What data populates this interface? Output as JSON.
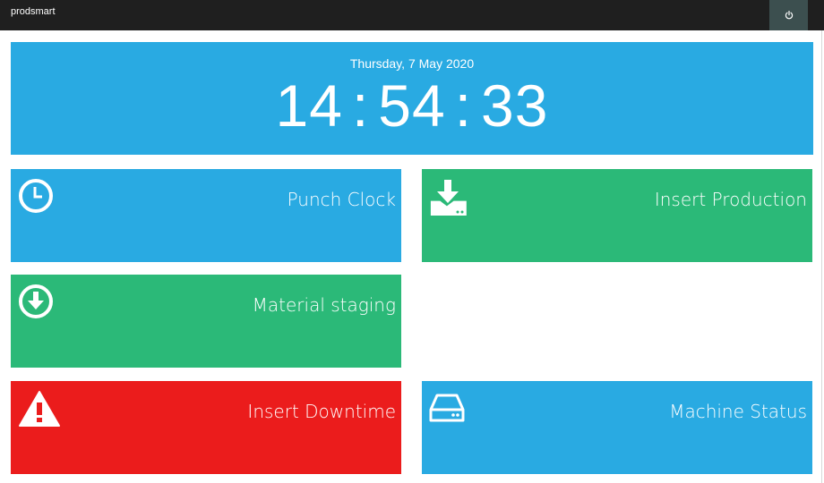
{
  "app": {
    "brand": "prodsmart"
  },
  "header": {
    "power_icon": "power-icon"
  },
  "clock": {
    "date": "Thursday, 7 May 2020",
    "hours": "14",
    "minutes": "54",
    "seconds": "33",
    "separator": ":"
  },
  "tiles": [
    {
      "label": "Punch Clock",
      "icon": "clock-icon",
      "color": "#29aae2"
    },
    {
      "label": "Insert Production",
      "icon": "download-tray-icon",
      "color": "#2bb978"
    },
    {
      "label": "Material staging",
      "icon": "arrow-down-circle-icon",
      "color": "#2bb978"
    },
    {
      "label": "Insert Downtime",
      "icon": "warning-icon",
      "color": "#eb1c1c"
    },
    {
      "label": "Machine Status",
      "icon": "hard-drive-icon",
      "color": "#29aae2"
    }
  ],
  "colors": {
    "topbar": "#1f1f1f",
    "power_button": "#3c4f4f",
    "blue": "#29aae2",
    "green": "#2bb978",
    "red": "#eb1c1c"
  }
}
